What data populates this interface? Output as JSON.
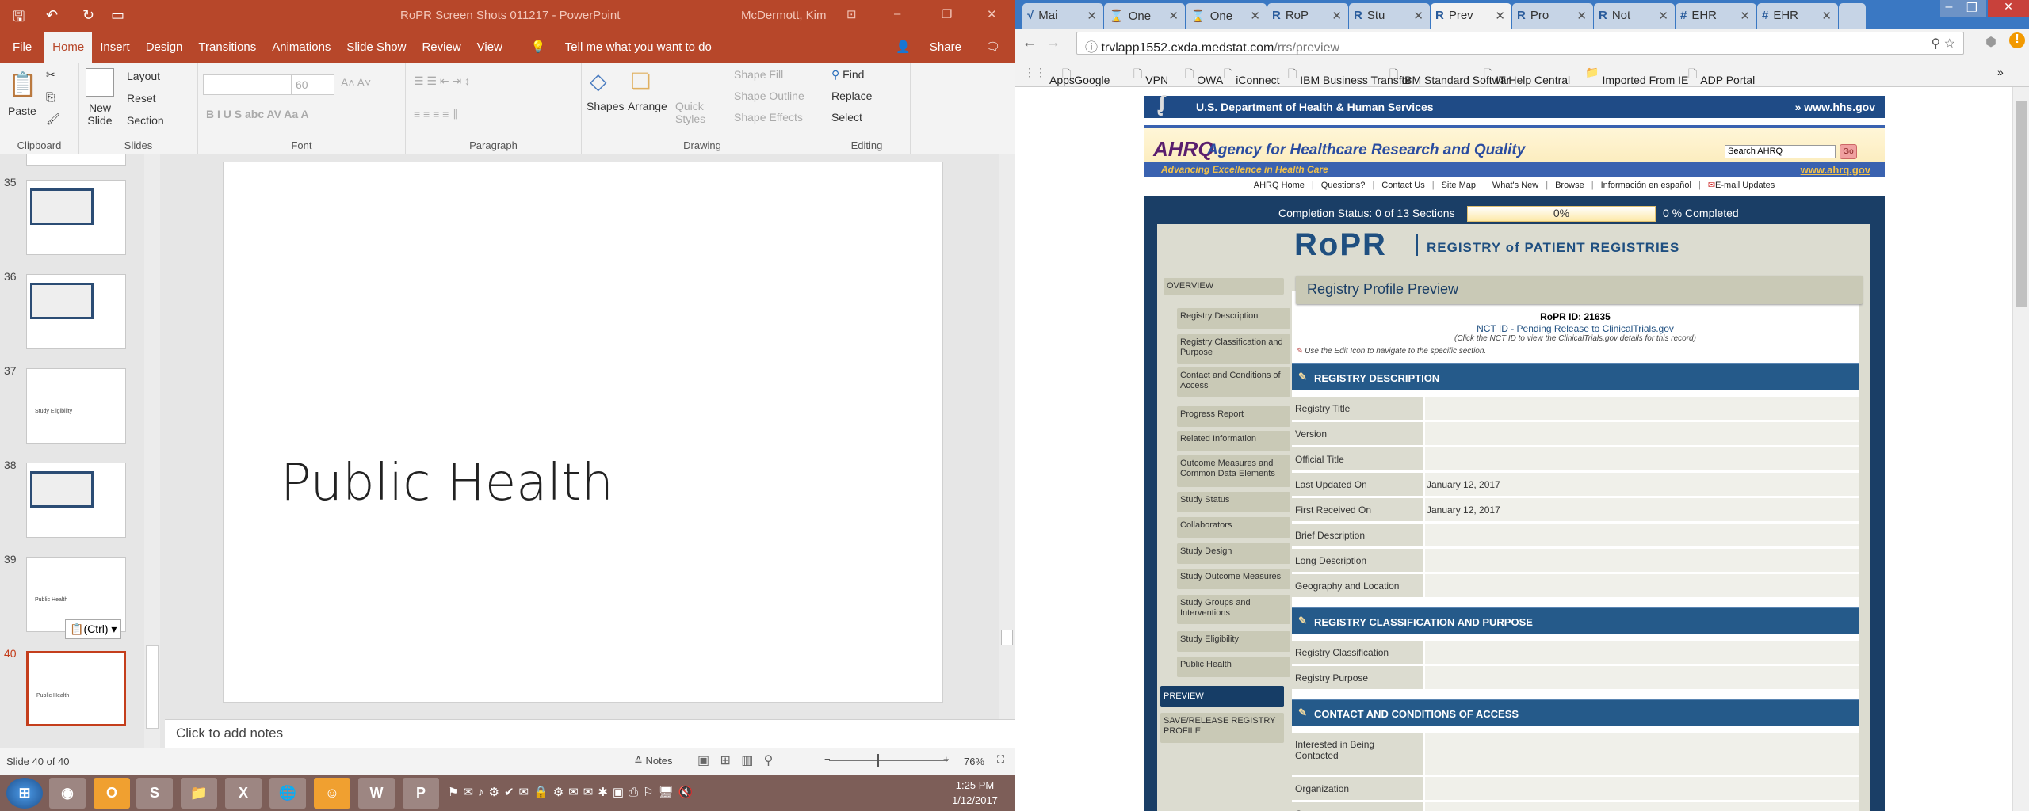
{
  "ppt": {
    "title": "RoPR Screen Shots 011217  -  PowerPoint",
    "user": "McDermott, Kim",
    "tabs": [
      "File",
      "Home",
      "Insert",
      "Design",
      "Transitions",
      "Animations",
      "Slide Show",
      "Review",
      "View"
    ],
    "tell_me": "Tell me what you want to do",
    "share": "Share",
    "ribbon": {
      "paste": "Paste",
      "new_slide": "New Slide",
      "layout": "Layout",
      "reset": "Reset",
      "section": "Section",
      "font_size": "60",
      "shapes": "Shapes",
      "arrange": "Arrange",
      "quick_styles": "Quick Styles",
      "shape_fill": "Shape Fill",
      "shape_outline": "Shape Outline",
      "shape_effects": "Shape Effects",
      "find": "Find",
      "replace": "Replace",
      "select": "Select",
      "groups": [
        "Clipboard",
        "Slides",
        "Font",
        "Paragraph",
        "Drawing",
        "Editing"
      ]
    },
    "thumbnails": [
      {
        "num": "35",
        "text": ""
      },
      {
        "num": "36",
        "text": ""
      },
      {
        "num": "37",
        "text": "Study Eligibility"
      },
      {
        "num": "38",
        "text": ""
      },
      {
        "num": "39",
        "text": "Public Health"
      },
      {
        "num": "40",
        "text": "Public Health"
      }
    ],
    "paste_options": "(Ctrl)",
    "slide_text": "Public Health",
    "notes_placeholder": "Click to add notes",
    "status": {
      "slide": "Slide 40 of 40",
      "notes": "Notes",
      "zoom": "76%",
      "zoom_percent": 76
    },
    "clock": {
      "time": "1:25 PM",
      "date": "1/12/2017"
    }
  },
  "browser": {
    "tabs": [
      {
        "icon": "√",
        "label": "Mai"
      },
      {
        "icon": "⌛",
        "label": "One"
      },
      {
        "icon": "⌛",
        "label": "One"
      },
      {
        "icon": "R",
        "label": "RoP"
      },
      {
        "icon": "R",
        "label": "Stu"
      },
      {
        "icon": "R",
        "label": "Prev"
      },
      {
        "icon": "R",
        "label": "Pro"
      },
      {
        "icon": "R",
        "label": "Not"
      },
      {
        "icon": "#",
        "label": "EHR"
      },
      {
        "icon": "#",
        "label": "EHR"
      }
    ],
    "url_host": "trvlapp1552.cxda.medstat.com",
    "url_path": "/rrs/preview",
    "bookmarks": [
      "Apps",
      "Google",
      "VPN",
      "OWA",
      "iConnect",
      "IBM Business Transfor",
      "IBM Standard Softwar",
      "IT Help Central",
      "Imported From IE",
      "ADP Portal"
    ]
  },
  "site": {
    "hhs": "U.S. Department of Health & Human Services",
    "hhs_link": "www.hhs.gov",
    "ahrq_logo": "AHRQ",
    "agency": "Agency for Healthcare Research and Quality",
    "tagline": "Advancing Excellence in Health Care",
    "ahrq_link": "www.ahrq.gov",
    "search_placeholder": "Search AHRQ",
    "go": "Go",
    "nav": [
      "AHRQ Home",
      "Questions?",
      "Contact Us",
      "Site Map",
      "What's New",
      "Browse",
      "Información en español",
      "E-mail Updates"
    ],
    "completion_label": "Completion Status: 0 of 13 Sections",
    "completion_bar": "0%",
    "completion_percent": 0,
    "completed": "0 % Completed",
    "logo": "RoPR",
    "logo_sub": "REGISTRY of PATIENT REGISTRIES",
    "left_nav": {
      "overview": "OVERVIEW",
      "items": [
        "Registry Description",
        "Registry Classification and Purpose",
        "Contact and Conditions of Access",
        "Progress Report",
        "Related Information",
        "Outcome Measures and Common Data Elements",
        "Study Status",
        "Collaborators",
        "Study Design",
        "Study Outcome Measures",
        "Study Groups and Interventions",
        "Study Eligibility",
        "Public Health"
      ],
      "preview": "PREVIEW",
      "save": "SAVE/RELEASE REGISTRY PROFILE"
    },
    "page_title": "Registry Profile Preview",
    "ropr_id": "RoPR ID: 21635",
    "nct_link": "NCT ID - Pending Release to ClinicalTrials.gov",
    "nct_note": "(Click the NCT ID to view the ClinicalTrials.gov details for this record)",
    "edit_hint": "Use the Edit Icon to navigate to the specific section.",
    "sections": [
      {
        "title": "REGISTRY DESCRIPTION",
        "rows": [
          [
            "Registry Title",
            ""
          ],
          [
            "Version",
            ""
          ],
          [
            "Official Title",
            ""
          ],
          [
            "Last Updated On",
            "January 12, 2017"
          ],
          [
            "First Received On",
            "January 12, 2017"
          ],
          [
            "Brief Description",
            ""
          ],
          [
            "Long Description",
            ""
          ],
          [
            "Geography and Location",
            ""
          ]
        ]
      },
      {
        "title": "REGISTRY CLASSIFICATION AND PURPOSE",
        "rows": [
          [
            "Registry Classification",
            ""
          ],
          [
            "Registry Purpose",
            ""
          ]
        ]
      },
      {
        "title": "CONTACT AND CONDITIONS OF ACCESS",
        "rows": [
          [
            "Interested in Being Contacted",
            ""
          ],
          [
            "Organization",
            ""
          ],
          [
            "Contact",
            ""
          ]
        ]
      }
    ]
  }
}
